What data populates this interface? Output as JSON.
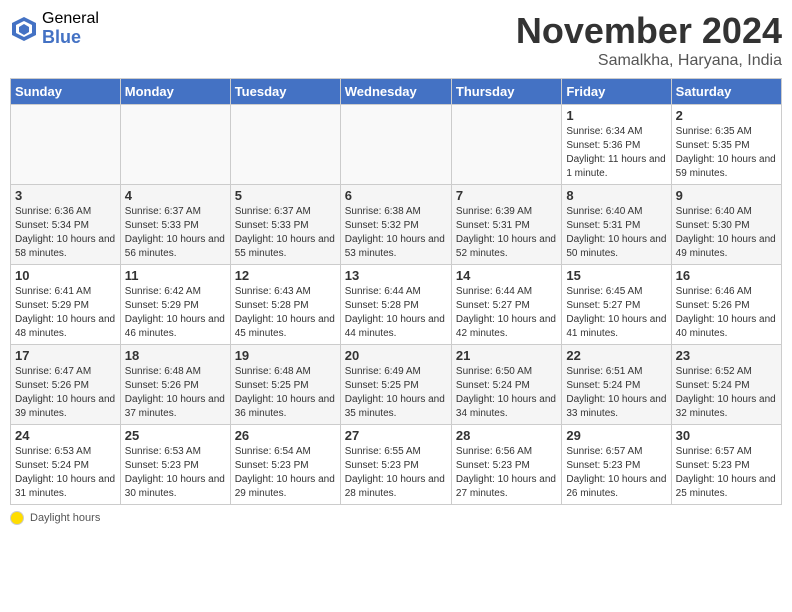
{
  "header": {
    "logo_general": "General",
    "logo_blue": "Blue",
    "month_title": "November 2024",
    "location": "Samalkha, Haryana, India"
  },
  "days_of_week": [
    "Sunday",
    "Monday",
    "Tuesday",
    "Wednesday",
    "Thursday",
    "Friday",
    "Saturday"
  ],
  "legend_label": "Daylight hours",
  "weeks": [
    [
      {
        "day": "",
        "info": ""
      },
      {
        "day": "",
        "info": ""
      },
      {
        "day": "",
        "info": ""
      },
      {
        "day": "",
        "info": ""
      },
      {
        "day": "",
        "info": ""
      },
      {
        "day": "1",
        "info": "Sunrise: 6:34 AM\nSunset: 5:36 PM\nDaylight: 11 hours and 1 minute."
      },
      {
        "day": "2",
        "info": "Sunrise: 6:35 AM\nSunset: 5:35 PM\nDaylight: 10 hours and 59 minutes."
      }
    ],
    [
      {
        "day": "3",
        "info": "Sunrise: 6:36 AM\nSunset: 5:34 PM\nDaylight: 10 hours and 58 minutes."
      },
      {
        "day": "4",
        "info": "Sunrise: 6:37 AM\nSunset: 5:33 PM\nDaylight: 10 hours and 56 minutes."
      },
      {
        "day": "5",
        "info": "Sunrise: 6:37 AM\nSunset: 5:33 PM\nDaylight: 10 hours and 55 minutes."
      },
      {
        "day": "6",
        "info": "Sunrise: 6:38 AM\nSunset: 5:32 PM\nDaylight: 10 hours and 53 minutes."
      },
      {
        "day": "7",
        "info": "Sunrise: 6:39 AM\nSunset: 5:31 PM\nDaylight: 10 hours and 52 minutes."
      },
      {
        "day": "8",
        "info": "Sunrise: 6:40 AM\nSunset: 5:31 PM\nDaylight: 10 hours and 50 minutes."
      },
      {
        "day": "9",
        "info": "Sunrise: 6:40 AM\nSunset: 5:30 PM\nDaylight: 10 hours and 49 minutes."
      }
    ],
    [
      {
        "day": "10",
        "info": "Sunrise: 6:41 AM\nSunset: 5:29 PM\nDaylight: 10 hours and 48 minutes."
      },
      {
        "day": "11",
        "info": "Sunrise: 6:42 AM\nSunset: 5:29 PM\nDaylight: 10 hours and 46 minutes."
      },
      {
        "day": "12",
        "info": "Sunrise: 6:43 AM\nSunset: 5:28 PM\nDaylight: 10 hours and 45 minutes."
      },
      {
        "day": "13",
        "info": "Sunrise: 6:44 AM\nSunset: 5:28 PM\nDaylight: 10 hours and 44 minutes."
      },
      {
        "day": "14",
        "info": "Sunrise: 6:44 AM\nSunset: 5:27 PM\nDaylight: 10 hours and 42 minutes."
      },
      {
        "day": "15",
        "info": "Sunrise: 6:45 AM\nSunset: 5:27 PM\nDaylight: 10 hours and 41 minutes."
      },
      {
        "day": "16",
        "info": "Sunrise: 6:46 AM\nSunset: 5:26 PM\nDaylight: 10 hours and 40 minutes."
      }
    ],
    [
      {
        "day": "17",
        "info": "Sunrise: 6:47 AM\nSunset: 5:26 PM\nDaylight: 10 hours and 39 minutes."
      },
      {
        "day": "18",
        "info": "Sunrise: 6:48 AM\nSunset: 5:26 PM\nDaylight: 10 hours and 37 minutes."
      },
      {
        "day": "19",
        "info": "Sunrise: 6:48 AM\nSunset: 5:25 PM\nDaylight: 10 hours and 36 minutes."
      },
      {
        "day": "20",
        "info": "Sunrise: 6:49 AM\nSunset: 5:25 PM\nDaylight: 10 hours and 35 minutes."
      },
      {
        "day": "21",
        "info": "Sunrise: 6:50 AM\nSunset: 5:24 PM\nDaylight: 10 hours and 34 minutes."
      },
      {
        "day": "22",
        "info": "Sunrise: 6:51 AM\nSunset: 5:24 PM\nDaylight: 10 hours and 33 minutes."
      },
      {
        "day": "23",
        "info": "Sunrise: 6:52 AM\nSunset: 5:24 PM\nDaylight: 10 hours and 32 minutes."
      }
    ],
    [
      {
        "day": "24",
        "info": "Sunrise: 6:53 AM\nSunset: 5:24 PM\nDaylight: 10 hours and 31 minutes."
      },
      {
        "day": "25",
        "info": "Sunrise: 6:53 AM\nSunset: 5:23 PM\nDaylight: 10 hours and 30 minutes."
      },
      {
        "day": "26",
        "info": "Sunrise: 6:54 AM\nSunset: 5:23 PM\nDaylight: 10 hours and 29 minutes."
      },
      {
        "day": "27",
        "info": "Sunrise: 6:55 AM\nSunset: 5:23 PM\nDaylight: 10 hours and 28 minutes."
      },
      {
        "day": "28",
        "info": "Sunrise: 6:56 AM\nSunset: 5:23 PM\nDaylight: 10 hours and 27 minutes."
      },
      {
        "day": "29",
        "info": "Sunrise: 6:57 AM\nSunset: 5:23 PM\nDaylight: 10 hours and 26 minutes."
      },
      {
        "day": "30",
        "info": "Sunrise: 6:57 AM\nSunset: 5:23 PM\nDaylight: 10 hours and 25 minutes."
      }
    ]
  ]
}
